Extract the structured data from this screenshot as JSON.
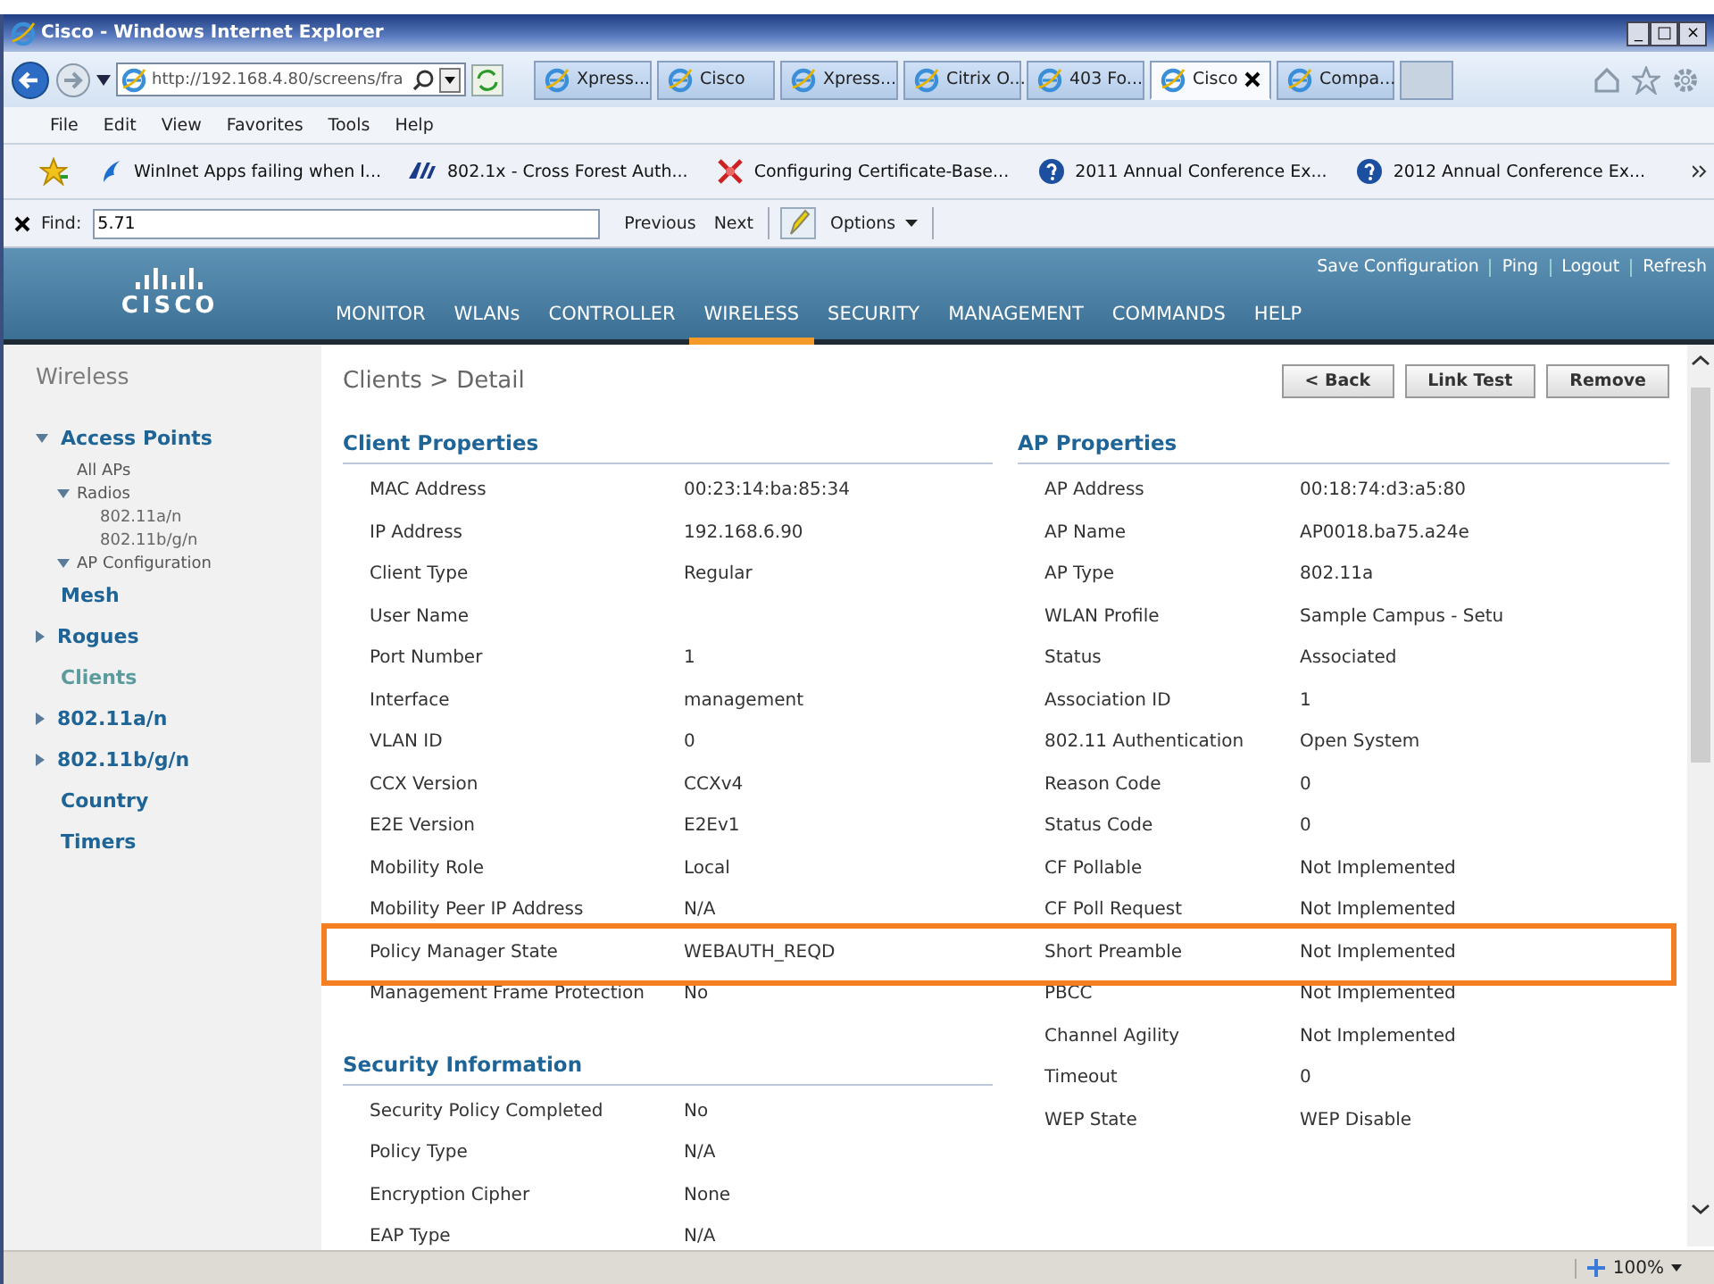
{
  "window": {
    "title": "Cisco - Windows Internet Explorer",
    "controls": [
      "_",
      "□",
      "×"
    ]
  },
  "browser": {
    "address": "http://192.168.4.80/screens/fra",
    "tabs": [
      {
        "label": "Xpress...",
        "selected": false
      },
      {
        "label": "Cisco",
        "selected": false
      },
      {
        "label": "Xpress...",
        "selected": false
      },
      {
        "label": "Citrix O...",
        "selected": false
      },
      {
        "label": "403 Fo...",
        "selected": false
      },
      {
        "label": "Cisco",
        "selected": true
      },
      {
        "label": "Compa...",
        "selected": false
      }
    ],
    "menu": [
      "File",
      "Edit",
      "View",
      "Favorites",
      "Tools",
      "Help"
    ],
    "favorites": [
      {
        "label": "WinInet Apps failing when I..."
      },
      {
        "label": "802.1x - Cross Forest Auth..."
      },
      {
        "label": "Configuring Certificate-Base..."
      },
      {
        "label": "2011 Annual Conference Ex..."
      },
      {
        "label": "2012 Annual Conference Ex..."
      }
    ],
    "find": {
      "label": "Find:",
      "value": "5.71",
      "previous": "Previous",
      "next": "Next",
      "options": "Options"
    },
    "zoom": "100%"
  },
  "header": {
    "logo": "CISCO",
    "links": [
      "Save Configuration",
      "Ping",
      "Logout",
      "Refresh"
    ],
    "nav": [
      {
        "label": "MONITOR",
        "selected": false
      },
      {
        "label": "WLANs",
        "selected": false
      },
      {
        "label": "CONTROLLER",
        "selected": false
      },
      {
        "label": "WIRELESS",
        "selected": true
      },
      {
        "label": "SECURITY",
        "selected": false
      },
      {
        "label": "MANAGEMENT",
        "selected": false
      },
      {
        "label": "COMMANDS",
        "selected": false
      },
      {
        "label": "HELP",
        "selected": false
      }
    ]
  },
  "sidebar": {
    "title": "Wireless",
    "items": [
      {
        "label": "Access Points",
        "expanded": true,
        "selected": false,
        "children": [
          {
            "label": "All APs",
            "selected": false
          },
          {
            "label": "Radios",
            "expanded": true,
            "selected": false,
            "children": [
              {
                "label": "802.11a/n",
                "selected": false
              },
              {
                "label": "802.11b/g/n",
                "selected": false
              }
            ]
          },
          {
            "label": "AP Configuration",
            "expanded": true,
            "selected": false
          }
        ]
      },
      {
        "label": "Mesh",
        "selected": false
      },
      {
        "label": "Rogues",
        "expanded": false,
        "selected": false
      },
      {
        "label": "Clients",
        "selected": true
      },
      {
        "label": "802.11a/n",
        "expanded": false,
        "selected": false
      },
      {
        "label": "802.11b/g/n",
        "expanded": false,
        "selected": false
      },
      {
        "label": "Country",
        "selected": false
      },
      {
        "label": "Timers",
        "selected": false
      }
    ]
  },
  "page": {
    "title": "Clients > Detail",
    "buttons": [
      "< Back",
      "Link Test",
      "Remove"
    ],
    "columns": [
      [
        {
          "title": "Client Properties",
          "rows": [
            {
              "label": "MAC Address",
              "value": "00:23:14:ba:85:34",
              "highlighted": false
            },
            {
              "label": "IP Address",
              "value": "192.168.6.90",
              "highlighted": false
            },
            {
              "label": "Client Type",
              "value": "Regular",
              "highlighted": false
            },
            {
              "label": "User Name",
              "highlighted": false
            },
            {
              "label": "Port Number",
              "value": "1",
              "highlighted": false
            },
            {
              "label": "Interface",
              "value": "management",
              "highlighted": false
            },
            {
              "label": "VLAN ID",
              "value": "0",
              "highlighted": false
            },
            {
              "label": "CCX Version",
              "value": "CCXv4",
              "highlighted": false
            },
            {
              "label": "E2E Version",
              "value": "E2Ev1",
              "highlighted": false
            },
            {
              "label": "Mobility Role",
              "value": "Local",
              "highlighted": false
            },
            {
              "label": "Mobility Peer IP Address",
              "value": "N/A",
              "highlighted": false
            },
            {
              "label": "Policy Manager State",
              "value": "WEBAUTH_REQD",
              "highlighted": true
            },
            {
              "label": "Management Frame Protection",
              "value": "No",
              "highlighted": false
            }
          ]
        },
        {
          "title": "Security Information",
          "rows": [
            {
              "label": "Security Policy Completed",
              "value": "No",
              "highlighted": false
            },
            {
              "label": "Policy Type",
              "value": "N/A",
              "highlighted": false
            },
            {
              "label": "Encryption Cipher",
              "value": "None",
              "highlighted": false
            },
            {
              "label": "EAP Type",
              "value": "N/A",
              "highlighted": false
            }
          ]
        }
      ],
      [
        {
          "title": "AP Properties",
          "rows": [
            {
              "label": "AP Address",
              "value": "00:18:74:d3:a5:80",
              "highlighted": false
            },
            {
              "label": "AP Name",
              "value": "AP0018.ba75.a24e",
              "highlighted": false
            },
            {
              "label": "AP Type",
              "value": "802.11a",
              "highlighted": false
            },
            {
              "label": "WLAN Profile",
              "value": "Sample Campus - Setu",
              "highlighted": false
            },
            {
              "label": "Status",
              "value": "Associated",
              "highlighted": false
            },
            {
              "label": "Association ID",
              "value": "1",
              "highlighted": false
            },
            {
              "label": "802.11 Authentication",
              "value": "Open System",
              "highlighted": false
            },
            {
              "label": "Reason Code",
              "value": "0",
              "highlighted": false
            },
            {
              "label": "Status Code",
              "value": "0",
              "highlighted": false
            },
            {
              "label": "CF Pollable",
              "value": "Not Implemented",
              "highlighted": false
            },
            {
              "label": "CF Poll Request",
              "value": "Not Implemented",
              "highlighted": false
            },
            {
              "label": "Short Preamble",
              "value": "Not Implemented",
              "highlighted": true
            },
            {
              "label": "PBCC",
              "value": "Not Implemented",
              "highlighted": false
            },
            {
              "label": "Channel Agility",
              "value": "Not Implemented",
              "highlighted": false
            },
            {
              "label": "Timeout",
              "value": "0",
              "highlighted": false
            },
            {
              "label": "WEP State",
              "value": "WEP Disable",
              "highlighted": false
            }
          ]
        }
      ]
    ]
  }
}
